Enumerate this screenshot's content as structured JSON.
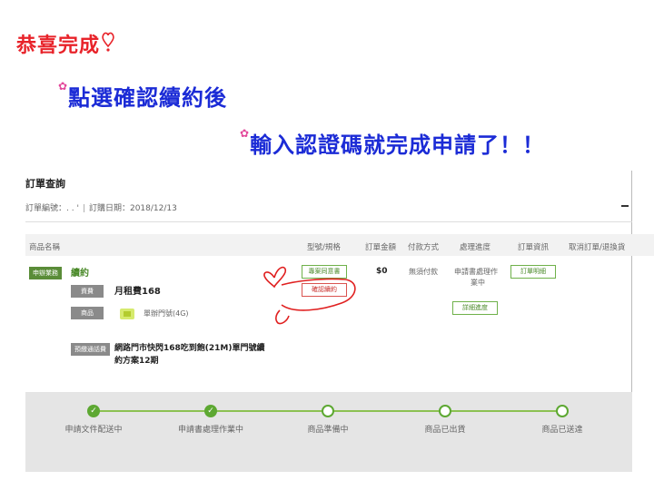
{
  "captions": {
    "line1": "恭喜完成",
    "line2": "點選確認續約後",
    "line3": "輸入認證碼就完成申請了！！"
  },
  "section": {
    "title": "訂單查詢",
    "order_no_label": "訂單編號：",
    "order_no_value": ". .      '",
    "order_date": "訂購日期：2018/12/13"
  },
  "table": {
    "headers": [
      "商品名稱",
      "型號/規格",
      "訂單金額",
      "付款方式",
      "處理進度",
      "訂單資訊",
      "取消訂單/退換貨"
    ],
    "row": {
      "type_tag": "申辦業務",
      "type_name": "續約",
      "fee_tag": "資費",
      "fee_name": "月租費168",
      "product_tag": "商品",
      "product_name": "單辦門號(4G)",
      "plan_tag": "預繳通話費",
      "plan_line1": "網路門市快閃168吃到飽(21M)單門號續",
      "plan_line2": "約方案12期",
      "btn_contract": "專案同意書",
      "btn_confirm": "確認續約",
      "amount": "$0",
      "payment": "無須付款",
      "status_line1": "申請書處理作",
      "status_line2": "業中",
      "btn_detail": "詳細進度",
      "btn_order_info": "訂單明細"
    }
  },
  "progress": {
    "steps": [
      {
        "label": "申請文件配送中",
        "done": true
      },
      {
        "label": "申請書處理作業中",
        "done": true
      },
      {
        "label": "商品準備中",
        "done": false
      },
      {
        "label": "商品已出貨",
        "done": false
      },
      {
        "label": "商品已送達",
        "done": false
      }
    ],
    "accent": "#5da832"
  },
  "colors": {
    "caption_red": "#e8232a",
    "caption_blue": "#1b2bd6",
    "annotation_red": "#e02020"
  }
}
